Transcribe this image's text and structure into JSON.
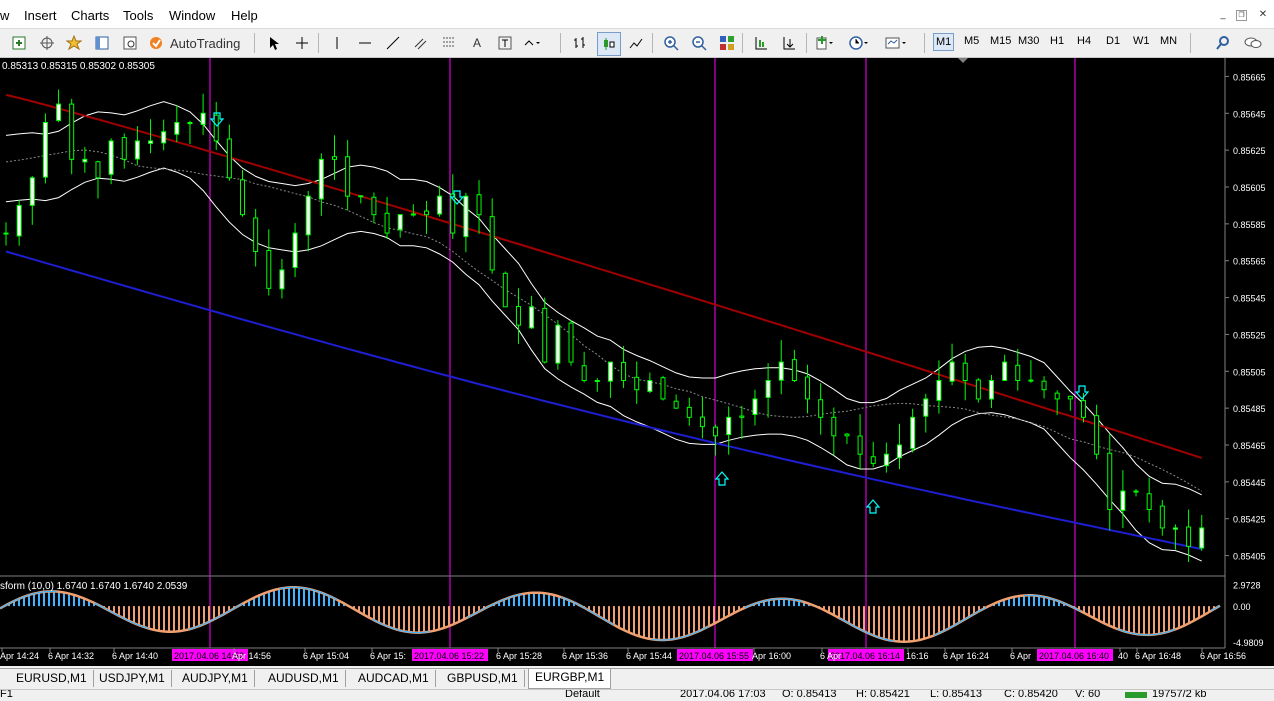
{
  "menu": [
    "w",
    "Insert",
    "Charts",
    "Tools",
    "Window",
    "Help"
  ],
  "toolbar": {
    "autotrading_label": "AutoTrading",
    "timeframes": [
      "M1",
      "M5",
      "M15",
      "M30",
      "H1",
      "H4",
      "D1",
      "W1",
      "MN"
    ],
    "active_timeframe": "M1"
  },
  "chart": {
    "ohlc_label": "0.85313 0.85315 0.85302 0.85305",
    "indicator_label": "sform (10,0) 1.6740 1.6740 1.6740 2.0539",
    "colors": {
      "background": "#000000",
      "bull": "#00ff00",
      "bear": "#ffffff",
      "ma_red": "#a00000",
      "ma_blue": "#1e1ed2",
      "vline": "#ff00ff",
      "arrow": "#00ffff",
      "hist_up": "#40b4ff",
      "hist_down": "#f0a070"
    }
  },
  "chart_data": {
    "type": "candlestick",
    "price_ticks": [
      "0.85665",
      "0.85645",
      "0.85625",
      "0.85605",
      "0.85585",
      "0.85565",
      "0.85545",
      "0.85525",
      "0.85505",
      "0.85485",
      "0.85465",
      "0.85445",
      "0.85425",
      "0.85405"
    ],
    "ylim": [
      0.85395,
      0.85675
    ],
    "indicator_ticks": [
      "2.9728",
      "0.00",
      "-4.9809"
    ],
    "indicator_ylim": [
      -5.5,
      3.6
    ],
    "time_ticks": [
      "Apr 14:24",
      "6 Apr 14:32",
      "6 Apr 14:40",
      "Apr 14:56",
      "6 Apr 15:04",
      "6 Apr 15:",
      "6 Apr 15:28",
      "6 Apr 15:36",
      "6 Apr 15:44",
      "Apr 16:00",
      "6 Apr",
      "16:16",
      "6 Apr 16:24",
      "6 Apr",
      "40",
      "6 Apr 16:48",
      "6 Apr 16:56"
    ],
    "vline_times": [
      "2017.04.06 14:52",
      "2017.04.06 15:22",
      "2017.04.06 15:55",
      "2017.04.06 16:14",
      "2017.04.06 16:40"
    ],
    "close_path": [
      0.8558,
      0.85595,
      0.8561,
      0.8564,
      0.8565,
      0.8562,
      0.8562,
      0.8561,
      0.8563,
      0.8562,
      0.8563,
      0.8563,
      0.85635,
      0.8564,
      0.8564,
      0.85645,
      0.8563,
      0.8561,
      0.8559,
      0.8557,
      0.8555,
      0.8556,
      0.8558,
      0.856,
      0.8562,
      0.8562,
      0.856,
      0.856,
      0.8559,
      0.8558,
      0.8559,
      0.8559,
      0.8559,
      0.856,
      0.8558,
      0.856,
      0.8559,
      0.8556,
      0.8554,
      0.8553,
      0.8554,
      0.8551,
      0.8553,
      0.8551,
      0.855,
      0.855,
      0.8551,
      0.855,
      0.85495,
      0.855,
      0.8549,
      0.85485,
      0.8548,
      0.85475,
      0.8547,
      0.8548,
      0.8548,
      0.8549,
      0.855,
      0.8551,
      0.855,
      0.8549,
      0.8548,
      0.8547,
      0.8547,
      0.8546,
      0.85455,
      0.8546,
      0.85465,
      0.8548,
      0.8549,
      0.855,
      0.8551,
      0.855,
      0.8549,
      0.855,
      0.8551,
      0.855,
      0.855,
      0.85495,
      0.8549,
      0.8549,
      0.8548,
      0.8546,
      0.8543,
      0.8544,
      0.8544,
      0.8543,
      0.8542,
      0.8542,
      0.8541,
      0.8542
    ]
  },
  "tabs": [
    "EURUSD,M1",
    "USDJPY,M1",
    "AUDJPY,M1",
    "AUDUSD,M1",
    "AUDCAD,M1",
    "GBPUSD,M1",
    "EURGBP,M1"
  ],
  "active_tab": "EURGBP,M1",
  "status": {
    "left": "F1",
    "profile": "Default",
    "datetime": "2017.04.06 17:03",
    "open": "O: 0.85413",
    "high": "H: 0.85421",
    "low": "L: 0.85413",
    "close": "C: 0.85420",
    "volume": "V: 60",
    "traffic": "19757/2 kb"
  }
}
